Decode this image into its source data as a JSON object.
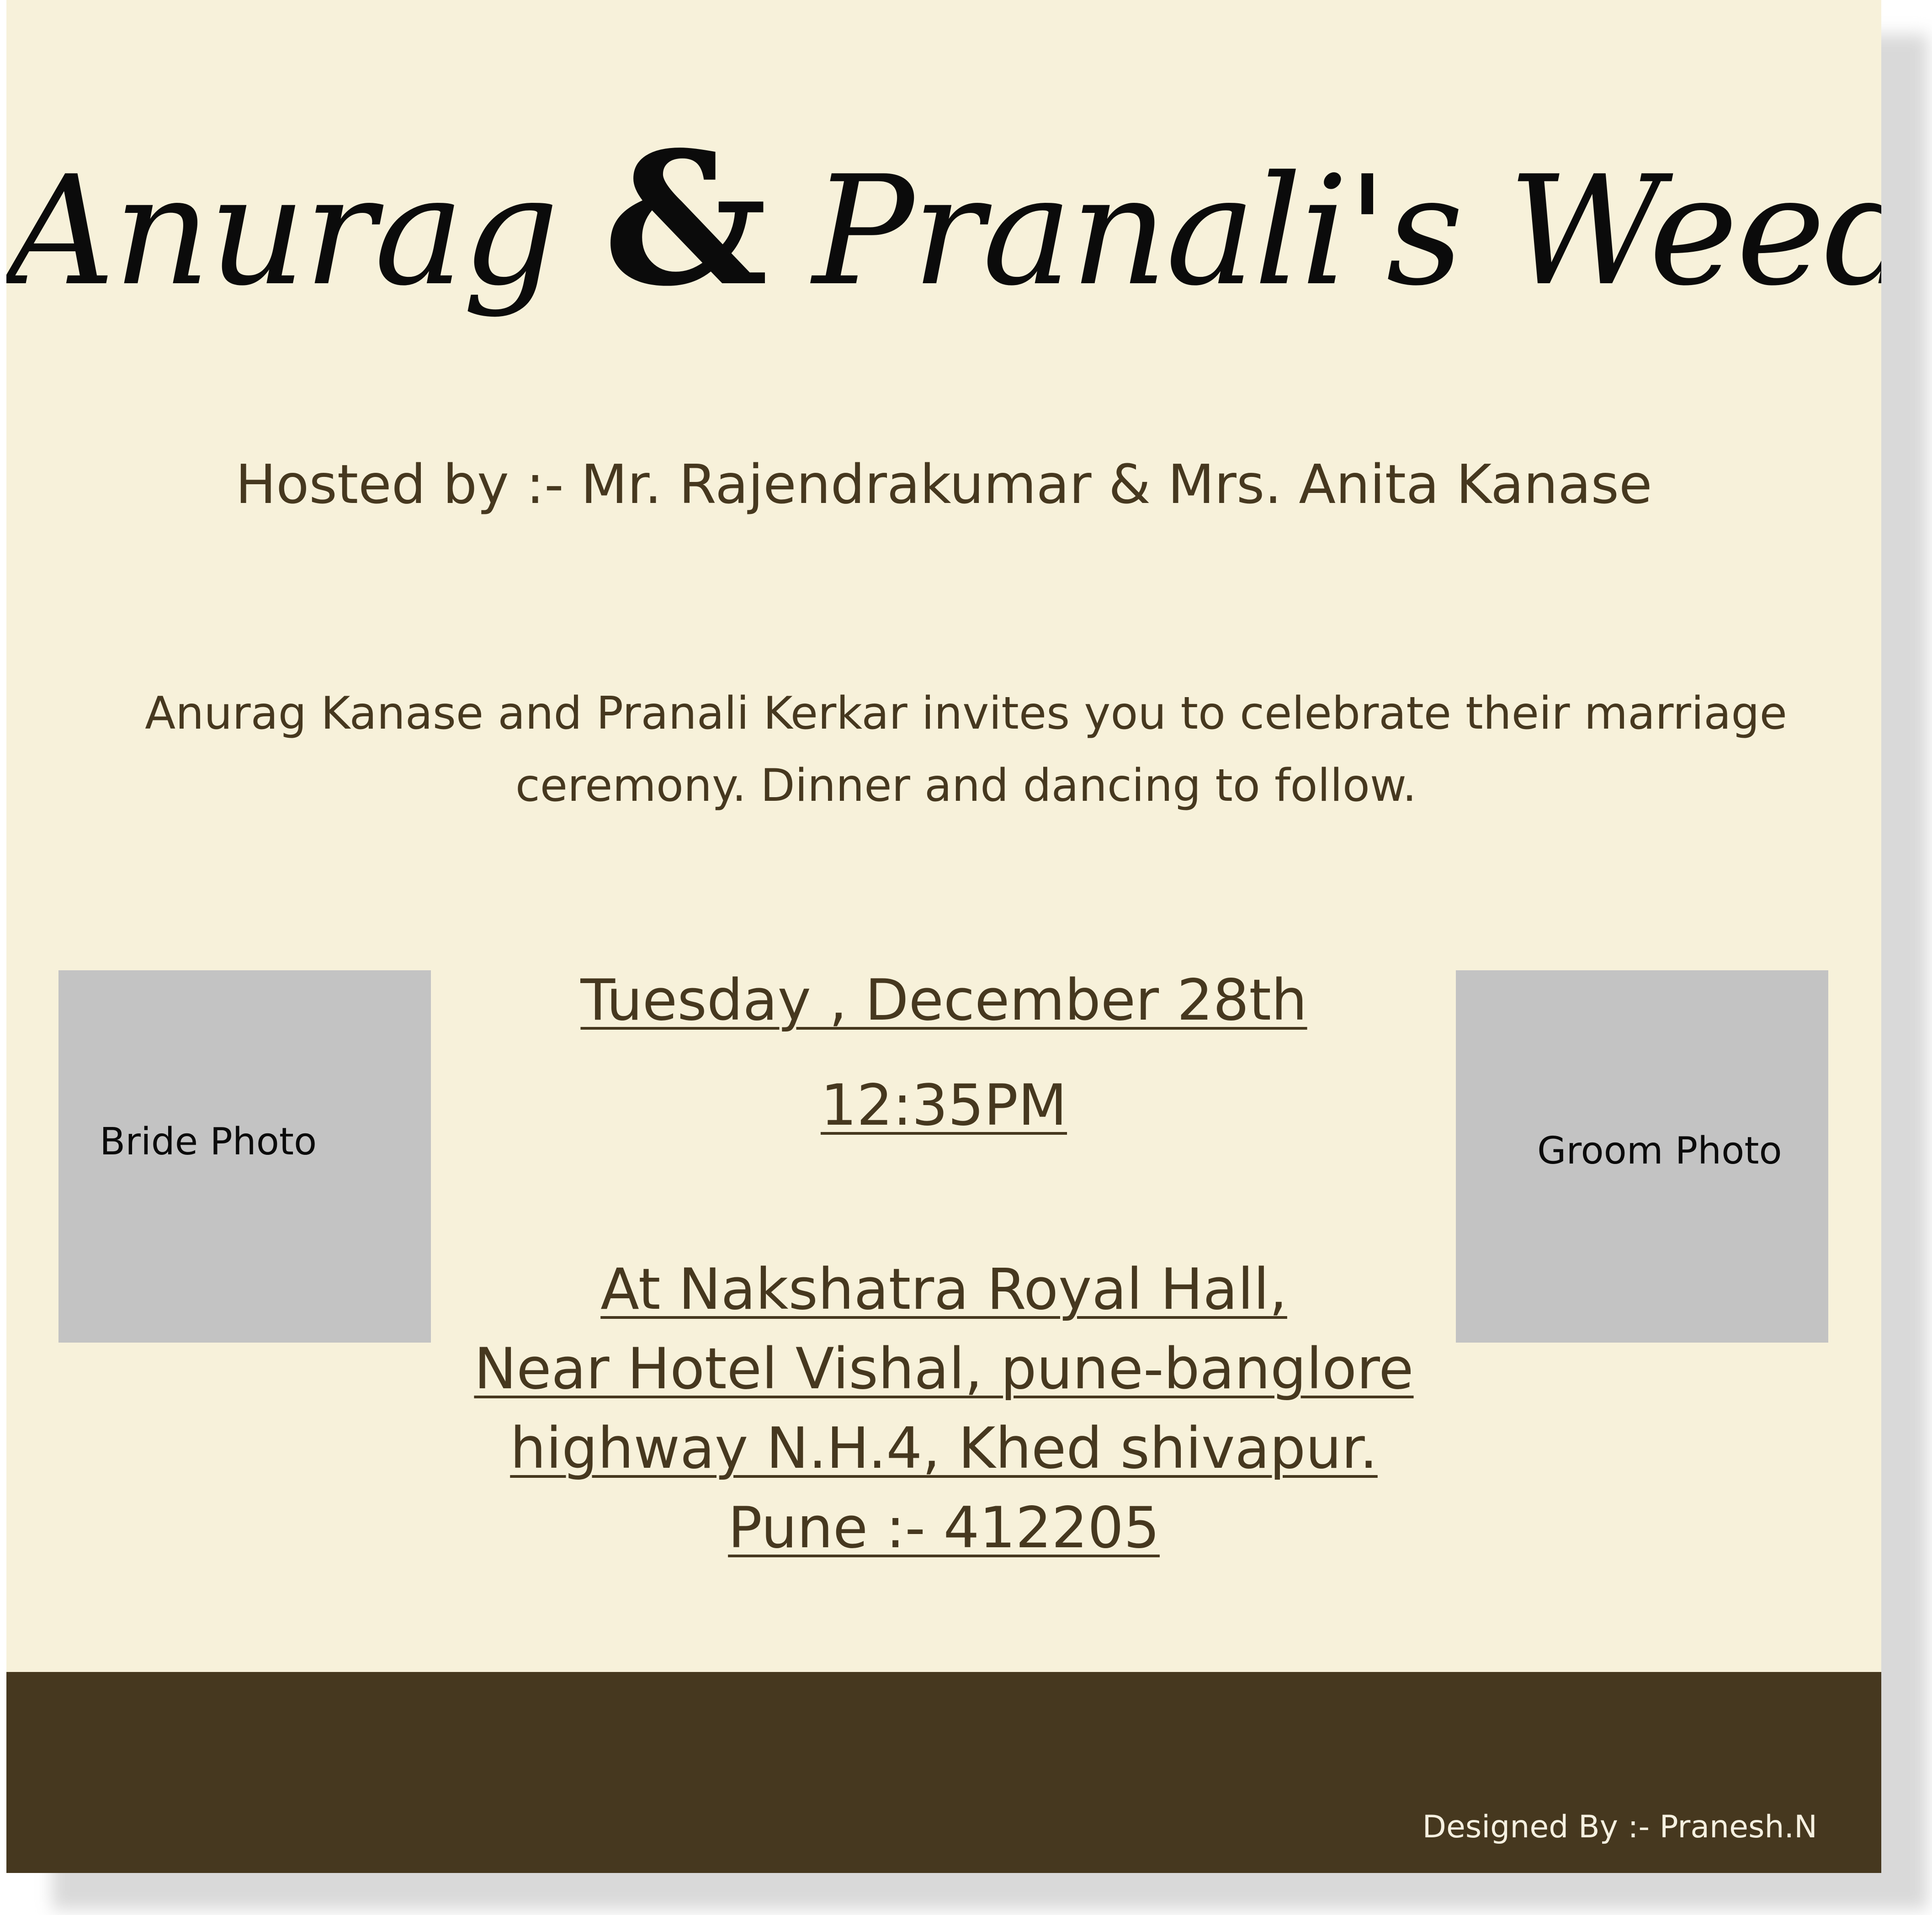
{
  "invitation": {
    "title_part1": "Anurag",
    "title_amp": "&",
    "title_part2": "Pranali's Weeding",
    "hosted_by": "Hosted by :- Mr. Rajendrakumar & Mrs. Anita Kanase",
    "invite_text": "Anurag Kanase and Pranali Kerkar invites you to celebrate their marriage ceremony. Dinner and dancing to follow.",
    "date": "Tuesday , December 28th",
    "time": "12:35PM",
    "venue": [
      "At   Nakshatra Royal Hall,",
      "Near Hotel Vishal, pune-banglore ",
      "highway N.H.4, Khed shivapur.",
      "Pune :- 412205"
    ],
    "bride_photo_label": "Bride Photo",
    "groom_photo_label": "Groom Photo"
  },
  "footer": {
    "credit": "Designed By :- Pranesh.N"
  },
  "colors": {
    "background": "#f7f1da",
    "text_brown": "#46381f",
    "footer": "#46381f",
    "photo_placeholder": "#c3c3c3"
  }
}
